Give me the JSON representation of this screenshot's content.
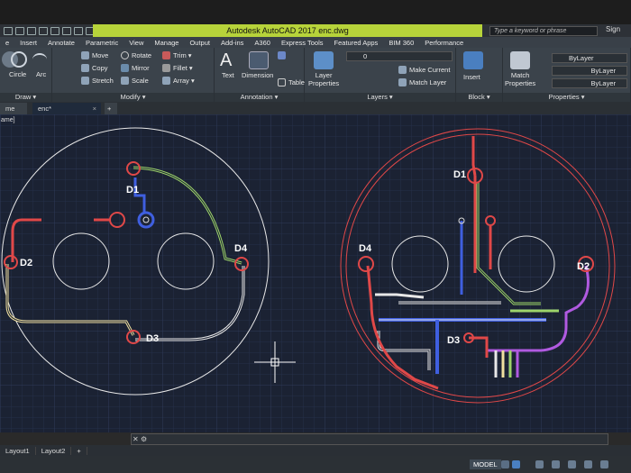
{
  "app": {
    "title": "Autodesk AutoCAD 2017    enc.dwg",
    "search_placeholder": "Type a keyword or phrase",
    "sign_in": "Sign"
  },
  "menu": [
    {
      "label": "e"
    },
    {
      "label": "Insert"
    },
    {
      "label": "Annotate"
    },
    {
      "label": "Parametric"
    },
    {
      "label": "View"
    },
    {
      "label": "Manage"
    },
    {
      "label": "Output"
    },
    {
      "label": "Add-ins"
    },
    {
      "label": "A360"
    },
    {
      "label": "Express Tools"
    },
    {
      "label": "Featured Apps"
    },
    {
      "label": "BIM 360"
    },
    {
      "label": "Performance"
    }
  ],
  "ribbon": {
    "draw": {
      "circle": "Circle",
      "arc": "Arc",
      "title": "Draw ▾"
    },
    "modify": {
      "move": "Move",
      "rotate": "Rotate",
      "trim": "Trim ▾",
      "copy": "Copy",
      "mirror": "Mirror",
      "fillet": "Fillet ▾",
      "stretch": "Stretch",
      "scale": "Scale",
      "array": "Array ▾",
      "title": "Modify ▾"
    },
    "annotation": {
      "text": "Text",
      "dimension": "Dimension",
      "table": "Table",
      "title": "Annotation ▾"
    },
    "layers": {
      "layer_properties": "Layer\nProperties",
      "layer_value": "0",
      "make_current": "Make Current",
      "match_layer": "Match Layer",
      "title": "Layers ▾"
    },
    "block": {
      "insert": "Insert",
      "title": "Block ▾"
    },
    "properties": {
      "match": "Match\nProperties",
      "color": "ByLayer",
      "linetype": "ByLayer",
      "lineweight": "ByLayer",
      "title": "Properties ▾"
    }
  },
  "tabs": [
    {
      "label": "me"
    },
    {
      "label": "enc*"
    }
  ],
  "viewport_label": "ame]",
  "drawing": {
    "left_labels": [
      "D1",
      "D2",
      "D3",
      "D4"
    ],
    "right_labels": [
      "D1",
      "D2",
      "D3",
      "D4"
    ]
  },
  "layouts": [
    {
      "label": "Layout1"
    },
    {
      "label": "Layout2"
    },
    {
      "label": "+"
    }
  ],
  "status": {
    "model": "MODEL"
  },
  "colors": {
    "accent_title": "#b7d33a",
    "canvas_bg": "#1b2233",
    "grid_minor": "#26304a",
    "grid_major": "#2f3b5a"
  }
}
